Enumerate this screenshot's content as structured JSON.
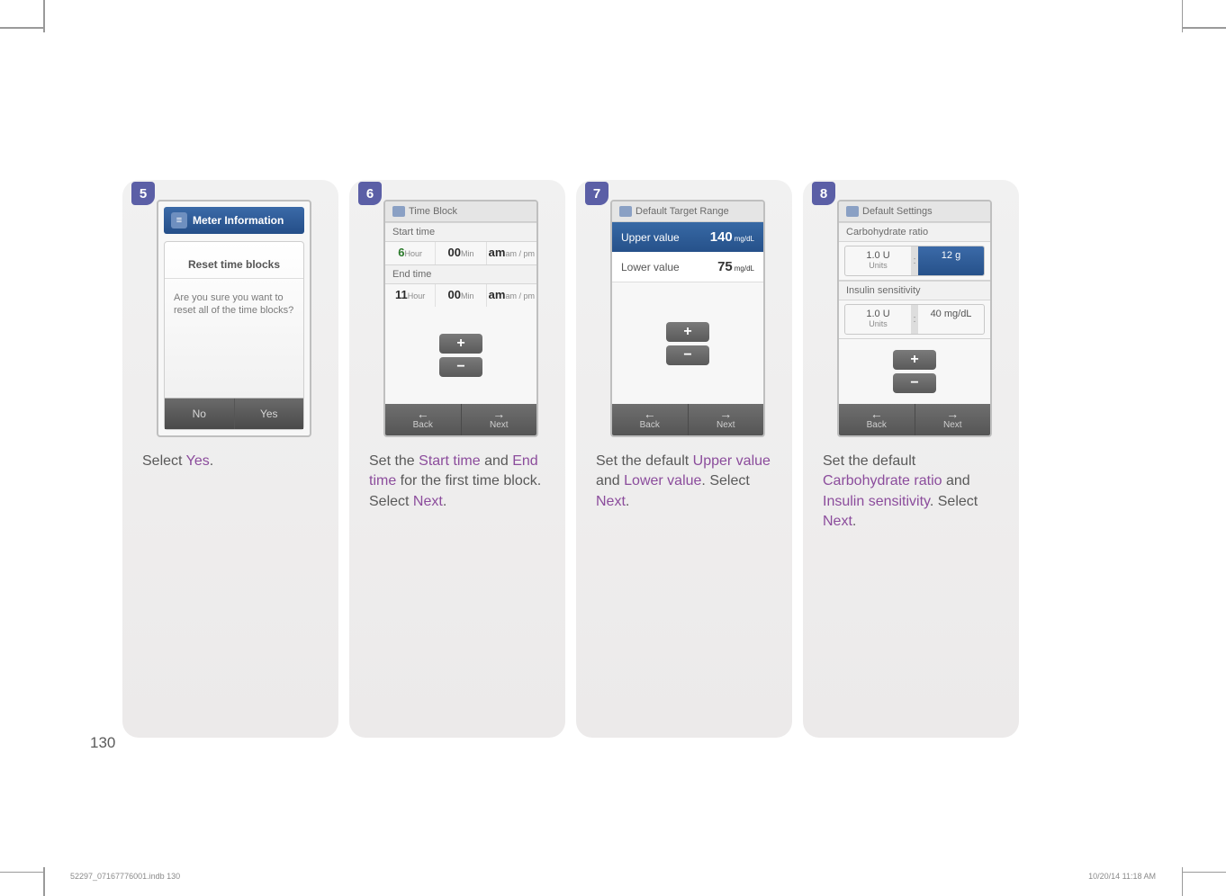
{
  "page_number": "130",
  "footer": {
    "file": "52297_07167776001.indb   130",
    "date": "10/20/14   11:18 AM"
  },
  "step5": {
    "num": "5",
    "header": "Meter Information",
    "title": "Reset time blocks",
    "message": "Are you sure you want to reset all of the time blocks?",
    "btn_no": "No",
    "btn_yes": "Yes",
    "caption_pre": "Select ",
    "caption_hl": "Yes",
    "caption_post": "."
  },
  "step6": {
    "num": "6",
    "title": "Time Block",
    "start_label": "Start time",
    "end_label": "End time",
    "start": {
      "hour": "6",
      "hour_l": "Hour",
      "min": "00",
      "min_l": "Min",
      "ampm": "am",
      "ampm_l": "am / pm"
    },
    "end": {
      "hour": "11",
      "hour_l": "Hour",
      "min": "00",
      "min_l": "Min",
      "ampm": "am",
      "ampm_l": "am / pm"
    },
    "back": "Back",
    "next": "Next",
    "cap1a": "Set the ",
    "cap1b": "Start time",
    "cap1c": " and ",
    "cap1d": "End time",
    "cap1e": " for the first time block. Select ",
    "cap1f": "Next",
    "cap1g": "."
  },
  "step7": {
    "num": "7",
    "title": "Default Target Range",
    "upper_l": "Upper value",
    "upper_v": "140",
    "unit": "mg/dL",
    "lower_l": "Lower value",
    "lower_v": "75",
    "back": "Back",
    "next": "Next",
    "cap_a": "Set the default ",
    "cap_b": "Upper value",
    "cap_c": " and ",
    "cap_d": "Lower value",
    "cap_e": ". Select ",
    "cap_f": "Next",
    "cap_g": "."
  },
  "step8": {
    "num": "8",
    "title": "Default Settings",
    "carb_l": "Carbohydrate ratio",
    "ins_l": "Insulin sensitivity",
    "u_val": "1.0 U",
    "u_unit": "Units",
    "carb_r": "12 g",
    "ins_r": "40 mg/dL",
    "back": "Back",
    "next": "Next",
    "cap_a": "Set the default ",
    "cap_b": "Carbohydrate ratio",
    "cap_c": " and ",
    "cap_d": "Insulin sensitivity",
    "cap_e": ". Select ",
    "cap_f": "Next",
    "cap_g": "."
  }
}
